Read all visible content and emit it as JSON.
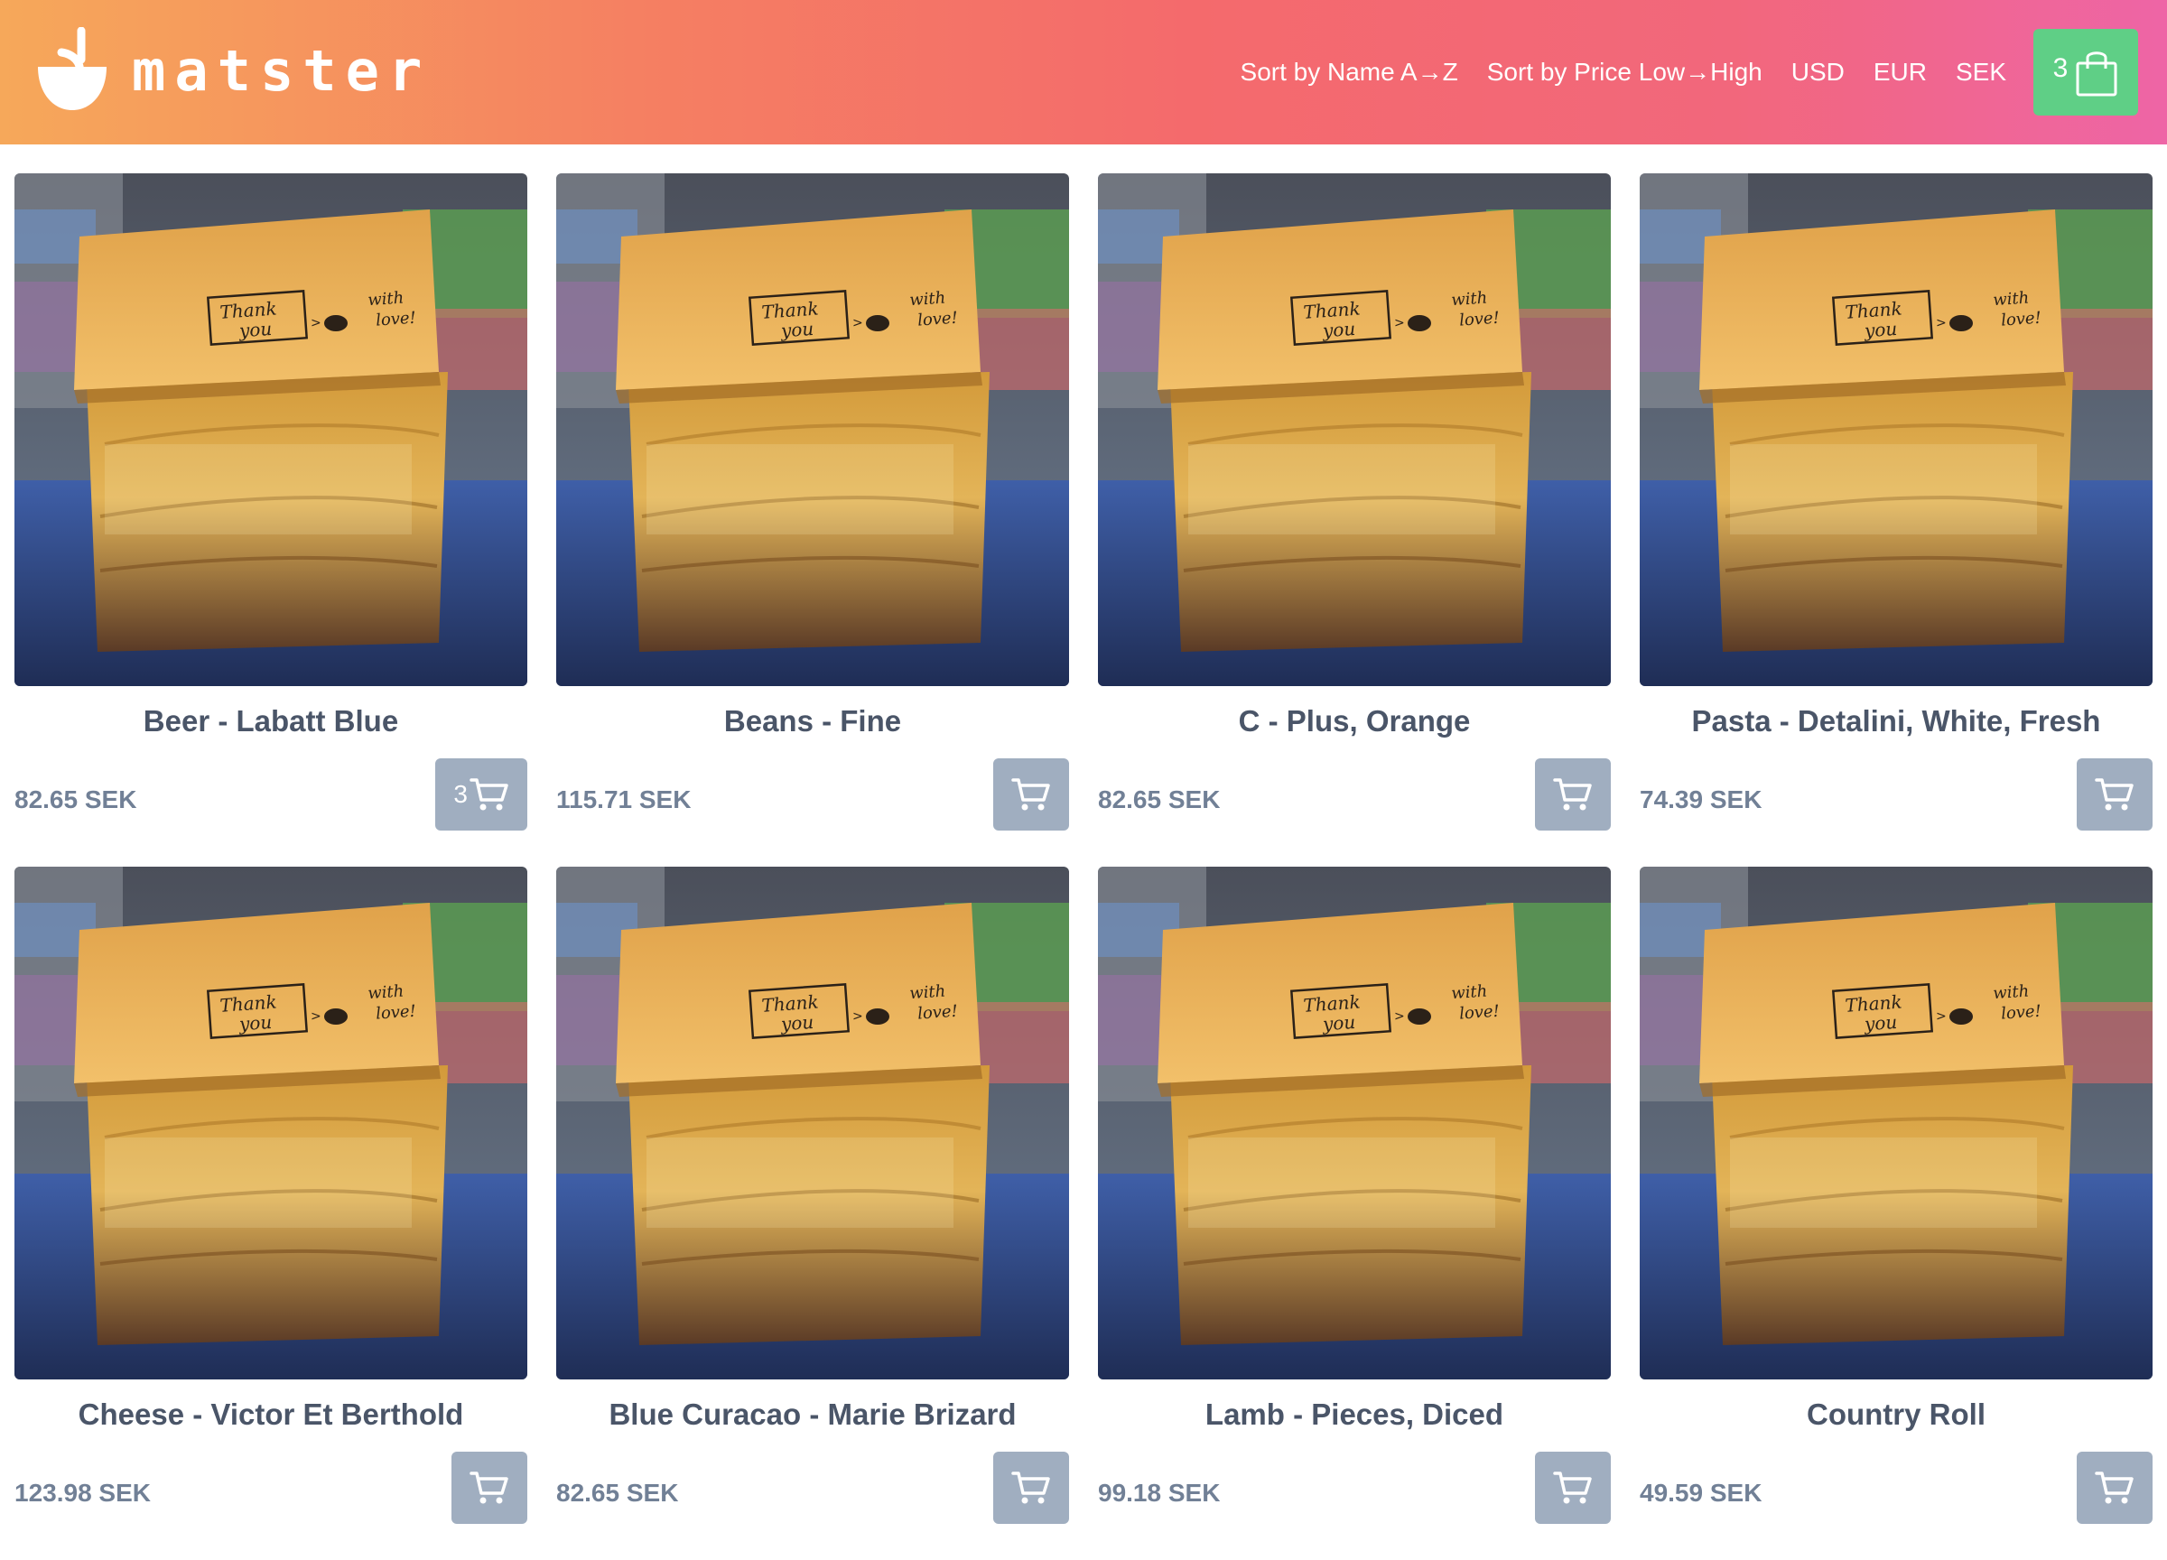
{
  "app": {
    "logo_text": "matster",
    "logo_icon": "bowl-icon"
  },
  "nav": {
    "sort_name": "Sort by Name A→Z",
    "sort_price": "Sort by Price Low→High",
    "usd": "USD",
    "eur": "EUR",
    "sek": "SEK"
  },
  "cart": {
    "count": "3",
    "icon": "shopping-bag-icon"
  },
  "colors": {
    "header_gradient_start": "#f6a85a",
    "header_gradient_end": "#ee65a6",
    "cart_button": "#5fcf86",
    "add_button": "#a0aec0",
    "title_text": "#4a5568",
    "price_text": "#718096"
  },
  "products": [
    {
      "name": "Beer - Labatt Blue",
      "price": "82.65 SEK",
      "in_cart": "3",
      "image": "paper-bag-photo"
    },
    {
      "name": "Beans - Fine",
      "price": "115.71 SEK",
      "in_cart": "",
      "image": "paper-bag-photo"
    },
    {
      "name": "C - Plus, Orange",
      "price": "82.65 SEK",
      "in_cart": "",
      "image": "paper-bag-photo"
    },
    {
      "name": "Pasta - Detalini, White, Fresh",
      "price": "74.39 SEK",
      "in_cart": "",
      "image": "paper-bag-photo"
    },
    {
      "name": "Cheese - Victor Et Berthold",
      "price": "123.98 SEK",
      "in_cart": "",
      "image": "paper-bag-photo"
    },
    {
      "name": "Blue Curacao - Marie Brizard",
      "price": "82.65 SEK",
      "in_cart": "",
      "image": "paper-bag-photo"
    },
    {
      "name": "Lamb - Pieces, Diced",
      "price": "99.18 SEK",
      "in_cart": "",
      "image": "paper-bag-photo"
    },
    {
      "name": "Country Roll",
      "price": "49.59 SEK",
      "in_cart": "",
      "image": "paper-bag-photo"
    }
  ],
  "photo_text": {
    "thank_you_1": "Thank",
    "thank_you_2": "you",
    "with_love_1": "with",
    "with_love_2": "love!"
  }
}
